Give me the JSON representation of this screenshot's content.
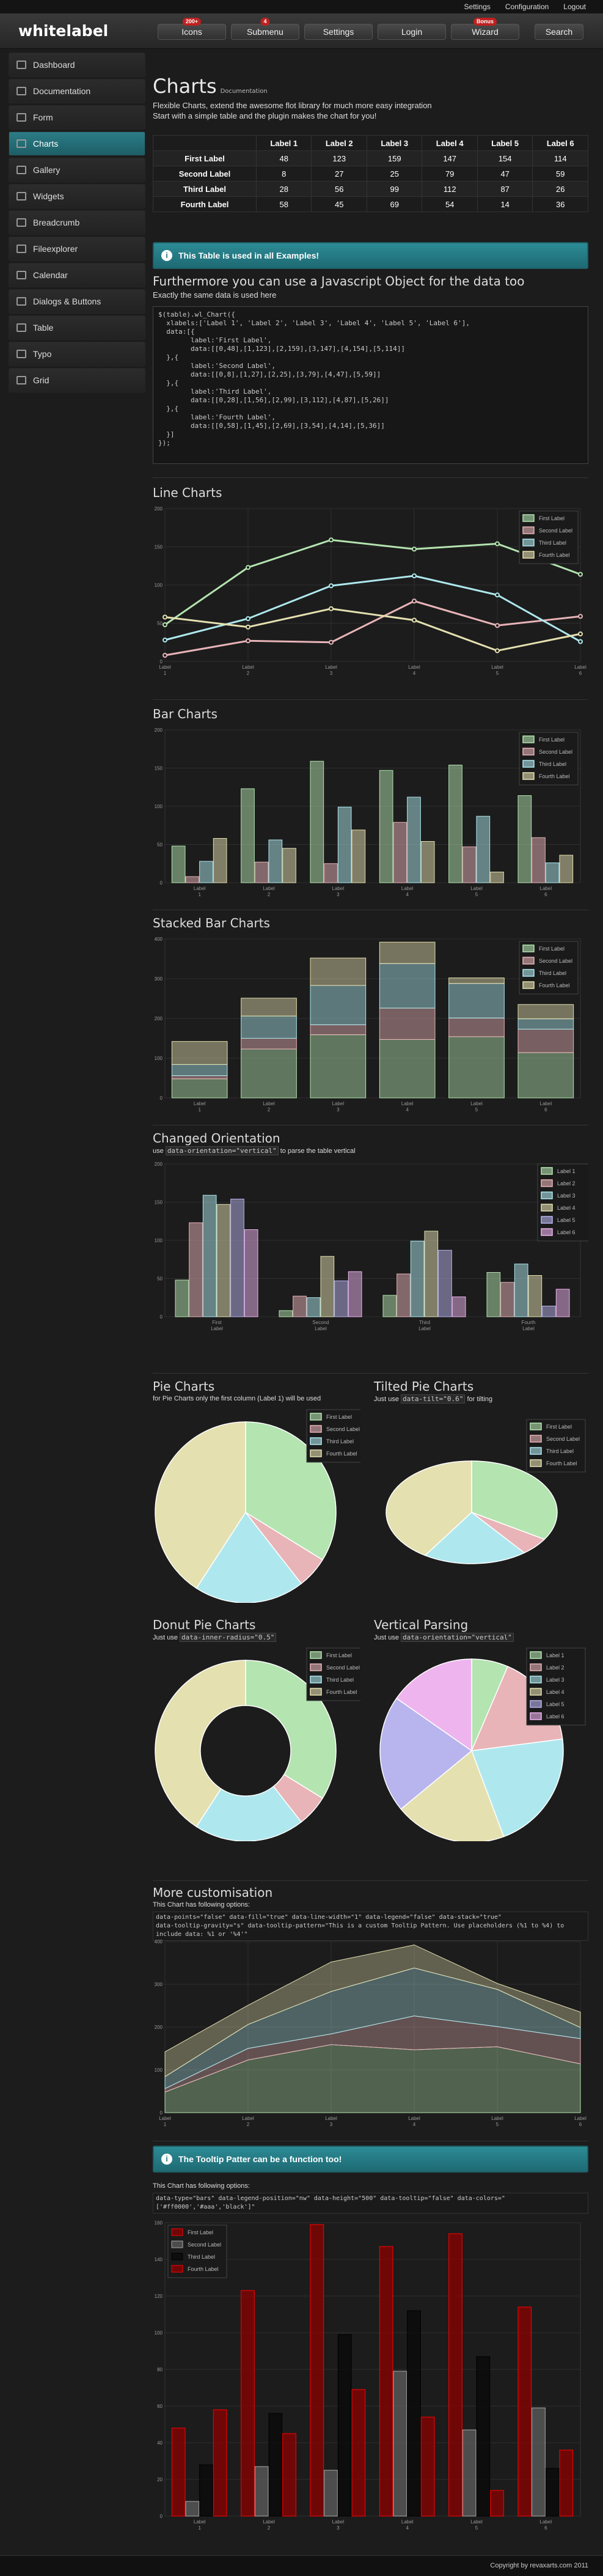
{
  "top_links": [
    "Settings",
    "Configuration",
    "Logout"
  ],
  "logo": "whitelabel",
  "nav": [
    {
      "label": "Icons",
      "badge": "200+"
    },
    {
      "label": "Submenu",
      "badge": "4"
    },
    {
      "label": "Settings",
      "badge": ""
    },
    {
      "label": "Login",
      "badge": ""
    },
    {
      "label": "Wizard",
      "badge": "Bonus"
    }
  ],
  "search": "Search",
  "sidebar": [
    {
      "label": "Dashboard",
      "active": false
    },
    {
      "label": "Documentation",
      "active": false
    },
    {
      "label": "Form",
      "active": false
    },
    {
      "label": "Charts",
      "active": true
    },
    {
      "label": "Gallery",
      "active": false
    },
    {
      "label": "Widgets",
      "active": false
    },
    {
      "label": "Breadcrumb",
      "active": false
    },
    {
      "label": "Fileexplorer",
      "active": false
    },
    {
      "label": "Calendar",
      "active": false
    },
    {
      "label": "Dialogs & Buttons",
      "active": false
    },
    {
      "label": "Table",
      "active": false
    },
    {
      "label": "Typo",
      "active": false
    },
    {
      "label": "Grid",
      "active": false
    }
  ],
  "page": {
    "title": "Charts",
    "subtitle": "Documentation",
    "intro1": "Flexible Charts, extend the awesome flot library for much more easy integration",
    "intro2": "Start with a simple table and the plugin makes the chart for you!"
  },
  "table": {
    "headers": [
      "",
      "Label 1",
      "Label 2",
      "Label 3",
      "Label 4",
      "Label 5",
      "Label 6"
    ],
    "rows": [
      [
        "First Label",
        "48",
        "123",
        "159",
        "147",
        "154",
        "114"
      ],
      [
        "Second Label",
        "8",
        "27",
        "25",
        "79",
        "47",
        "59"
      ],
      [
        "Third Label",
        "28",
        "56",
        "99",
        "112",
        "87",
        "26"
      ],
      [
        "Fourth Label",
        "58",
        "45",
        "69",
        "54",
        "14",
        "36"
      ]
    ]
  },
  "notice1": "This Table is used in all Examples!",
  "js": {
    "heading": "Furthermore you can use a Javascript Object for the data too",
    "sub": "Exactly the same data is used here",
    "code": "$(table).wl_Chart({\n  xlabels:['Label 1', 'Label 2', 'Label 3', 'Label 4', 'Label 5', 'Label 6'],\n  data:[{\n        label:'First Label',\n        data:[[0,48],[1,123],[2,159],[3,147],[4,154],[5,114]]\n  },{\n        label:'Second Label',\n        data:[[0,8],[1,27],[2,25],[3,79],[4,47],[5,59]]\n  },{\n        label:'Third Label',\n        data:[[0,28],[1,56],[2,99],[3,112],[4,87],[5,26]]\n  },{\n        label:'Fourth Label',\n        data:[[0,58],[1,45],[2,69],[3,54],[4,14],[5,36]]\n  }]\n});"
  },
  "titles": {
    "line": "Line Charts",
    "bar": "Bar Charts",
    "stacked": "Stacked Bar Charts",
    "changed": "Changed Orientation",
    "pie": "Pie Charts",
    "tilted": "Tilted Pie Charts",
    "donut": "Donut Pie Charts",
    "vertical": "Vertical Parsing",
    "more": "More customisation"
  },
  "descs": {
    "changed_pre": "use",
    "changed_code": "data-orientation=\"vertical\"",
    "changed_post": "to parse the table vertical",
    "pie": "for Pie Charts only the first column (Label 1) will be used",
    "tilted_pre": "Just use",
    "tilted_code": "data-tilt=\"0.6\"",
    "tilted_post": "for tilting",
    "donut_pre": "Just use",
    "donut_code": "data-inner-radius=\"0.5\"",
    "vertical_pre": "Just use",
    "vertical_code": "data-orientation=\"vertical\"",
    "more": "This Chart has following options:",
    "more_code": "data-points=\"false\" data-fill=\"true\" data-line-width=\"1\" data-legend=\"false\" data-stack=\"true\"\ndata-tooltip-gravity=\"s\" data-tooltip-pattern=\"This is a custom Tooltip Pattern. Use placeholders (%1 to %4) to\ninclude data: %1 or '%4'\""
  },
  "notice2": "The Tooltip Patter can be a function too!",
  "last": {
    "desc": "This Chart has following options:",
    "code": "data-type=\"bars\" data-legend-position=\"nw\" data-height=\"500\" data-tooltip=\"false\" data-colors=\"\n['#ff0000','#aaa','black']\""
  },
  "footer": "Copyright by revaxarts.com 2011",
  "colors": {
    "s1": "#b4e4b0",
    "s2": "#e8b4b8",
    "s3": "#aee8ee",
    "s4": "#e4e0b0",
    "accent": "#2a7d87"
  },
  "chart_data": [
    {
      "type": "line",
      "title": "Line Charts",
      "categories": [
        "Label 1",
        "Label 2",
        "Label 3",
        "Label 4",
        "Label 5",
        "Label 6"
      ],
      "ylim": [
        0,
        200
      ],
      "series": [
        {
          "name": "First Label",
          "values": [
            48,
            123,
            159,
            147,
            154,
            114
          ]
        },
        {
          "name": "Second Label",
          "values": [
            8,
            27,
            25,
            79,
            47,
            59
          ]
        },
        {
          "name": "Third Label",
          "values": [
            28,
            56,
            99,
            112,
            87,
            26
          ]
        },
        {
          "name": "Fourth Label",
          "values": [
            58,
            45,
            69,
            54,
            14,
            36
          ]
        }
      ],
      "legend": "top-right",
      "grid": true
    },
    {
      "type": "bar",
      "title": "Bar Charts",
      "categories": [
        "Label 1",
        "Label 2",
        "Label 3",
        "Label 4",
        "Label 5",
        "Label 6"
      ],
      "ylim": [
        0,
        200
      ],
      "series": [
        {
          "name": "First Label",
          "values": [
            48,
            123,
            159,
            147,
            154,
            114
          ]
        },
        {
          "name": "Second Label",
          "values": [
            8,
            27,
            25,
            79,
            47,
            59
          ]
        },
        {
          "name": "Third Label",
          "values": [
            28,
            56,
            99,
            112,
            87,
            26
          ]
        },
        {
          "name": "Fourth Label",
          "values": [
            58,
            45,
            69,
            54,
            14,
            36
          ]
        }
      ],
      "legend": "top-right"
    },
    {
      "type": "bar",
      "stacked": true,
      "title": "Stacked Bar Charts",
      "categories": [
        "Label 1",
        "Label 2",
        "Label 3",
        "Label 4",
        "Label 5",
        "Label 6"
      ],
      "ylim": [
        0,
        400
      ],
      "series": [
        {
          "name": "First Label",
          "values": [
            48,
            123,
            159,
            147,
            154,
            114
          ]
        },
        {
          "name": "Second Label",
          "values": [
            8,
            27,
            25,
            79,
            47,
            59
          ]
        },
        {
          "name": "Third Label",
          "values": [
            28,
            56,
            99,
            112,
            87,
            26
          ]
        },
        {
          "name": "Fourth Label",
          "values": [
            58,
            45,
            69,
            54,
            14,
            36
          ]
        }
      ],
      "legend": "top-right"
    },
    {
      "type": "bar",
      "title": "Changed Orientation",
      "categories": [
        "First Label",
        "Second Label",
        "Third Label",
        "Fourth Label"
      ],
      "ylim": [
        0,
        200
      ],
      "series": [
        {
          "name": "Label 1",
          "values": [
            48,
            8,
            28,
            58
          ]
        },
        {
          "name": "Label 2",
          "values": [
            123,
            27,
            56,
            45
          ]
        },
        {
          "name": "Label 3",
          "values": [
            159,
            25,
            99,
            69
          ]
        },
        {
          "name": "Label 4",
          "values": [
            147,
            79,
            112,
            54
          ]
        },
        {
          "name": "Label 5",
          "values": [
            154,
            47,
            87,
            14
          ]
        },
        {
          "name": "Label 6",
          "values": [
            114,
            59,
            26,
            36
          ]
        }
      ],
      "legend": "top-right"
    },
    {
      "type": "pie",
      "title": "Pie Charts",
      "labels": [
        "First Label",
        "Second Label",
        "Third Label",
        "Fourth Label"
      ],
      "values": [
        48,
        8,
        28,
        58
      ]
    },
    {
      "type": "pie",
      "title": "Tilted Pie Charts",
      "tilt": 0.6,
      "labels": [
        "First Label",
        "Second Label",
        "Third Label",
        "Fourth Label"
      ],
      "values": [
        48,
        8,
        28,
        58
      ]
    },
    {
      "type": "pie",
      "title": "Donut Pie Charts",
      "inner_radius": 0.5,
      "labels": [
        "First Label",
        "Second Label",
        "Third Label",
        "Fourth Label"
      ],
      "values": [
        48,
        8,
        28,
        58
      ]
    },
    {
      "type": "pie",
      "title": "Vertical Parsing",
      "labels": [
        "Label 1",
        "Label 2",
        "Label 3",
        "Label 4",
        "Label 5",
        "Label 6"
      ],
      "values": [
        48,
        123,
        159,
        147,
        154,
        114
      ]
    },
    {
      "type": "area",
      "stacked": true,
      "title": "More customisation",
      "categories": [
        "Label 1",
        "Label 2",
        "Label 3",
        "Label 4",
        "Label 5",
        "Label 6"
      ],
      "ylim": [
        0,
        400
      ],
      "series": [
        {
          "name": "First Label",
          "values": [
            48,
            123,
            159,
            147,
            154,
            114
          ]
        },
        {
          "name": "Second Label",
          "values": [
            8,
            27,
            25,
            79,
            47,
            59
          ]
        },
        {
          "name": "Third Label",
          "values": [
            28,
            56,
            99,
            112,
            87,
            26
          ]
        },
        {
          "name": "Fourth Label",
          "values": [
            58,
            45,
            69,
            54,
            14,
            36
          ]
        }
      ]
    },
    {
      "type": "bar",
      "title": "The Tooltip Patter can be a function too!",
      "categories": [
        "Label 1",
        "Label 2",
        "Label 3",
        "Label 4",
        "Label 5",
        "Label 6"
      ],
      "ylim": [
        0,
        160
      ],
      "series": [
        {
          "name": "First Label",
          "values": [
            48,
            123,
            159,
            147,
            154,
            114
          ]
        },
        {
          "name": "Second Label",
          "values": [
            8,
            27,
            25,
            79,
            47,
            59
          ]
        },
        {
          "name": "Third Label",
          "values": [
            28,
            56,
            99,
            112,
            87,
            26
          ]
        },
        {
          "name": "Fourth Label",
          "values": [
            58,
            45,
            69,
            54,
            14,
            36
          ]
        }
      ],
      "legend": "top-left",
      "colors": [
        "#ff0000",
        "#aaaaaa",
        "#000000",
        "#ff0000"
      ]
    }
  ]
}
